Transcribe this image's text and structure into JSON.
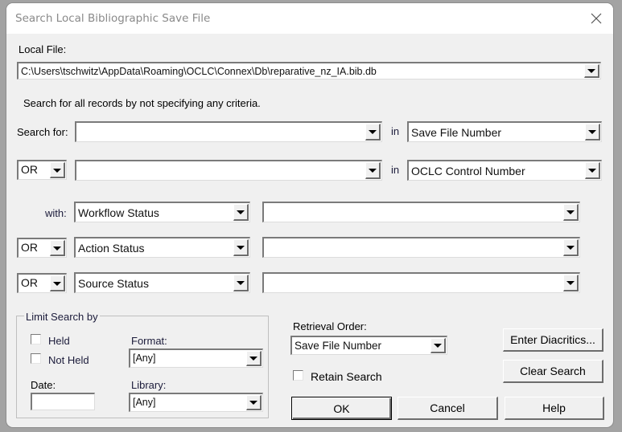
{
  "window": {
    "title": "Search Local Bibliographic Save File",
    "close_icon": "close-icon"
  },
  "local_file": {
    "label": "Local File:",
    "value": "C:\\Users\\tschwitz\\AppData\\Roaming\\OCLC\\Connex\\Db\\reparative_nz_IA.bib.db"
  },
  "hint": "Search for all records by not specifying any criteria.",
  "search_rows": [
    {
      "prefix_label": "Search for:",
      "term": "",
      "in_label": "in",
      "index": "Save File Number"
    },
    {
      "operator": "OR",
      "term": "",
      "in_label": "in",
      "index": "OCLC Control Number"
    }
  ],
  "status_rows": [
    {
      "prefix_label": "with:",
      "status_type": "Workflow Status",
      "status_value": ""
    },
    {
      "operator": "OR",
      "status_type": "Action Status",
      "status_value": ""
    },
    {
      "operator": "OR",
      "status_type": "Source Status",
      "status_value": ""
    }
  ],
  "limit": {
    "legend": "Limit Search by",
    "held_label": "Held",
    "held_checked": false,
    "not_held_label": "Not Held",
    "not_held_checked": false,
    "format_label": "Format:",
    "format_value": "[Any]",
    "date_label": "Date:",
    "date_value": "",
    "library_label": "Library:",
    "library_value": "[Any]"
  },
  "retrieval": {
    "label": "Retrieval Order:",
    "value": "Save File Number",
    "retain_label": "Retain Search",
    "retain_checked": false
  },
  "buttons": {
    "enter_diacritics": "Enter Diacritics...",
    "clear_search": "Clear Search",
    "ok": "OK",
    "cancel": "Cancel",
    "help": "Help"
  }
}
